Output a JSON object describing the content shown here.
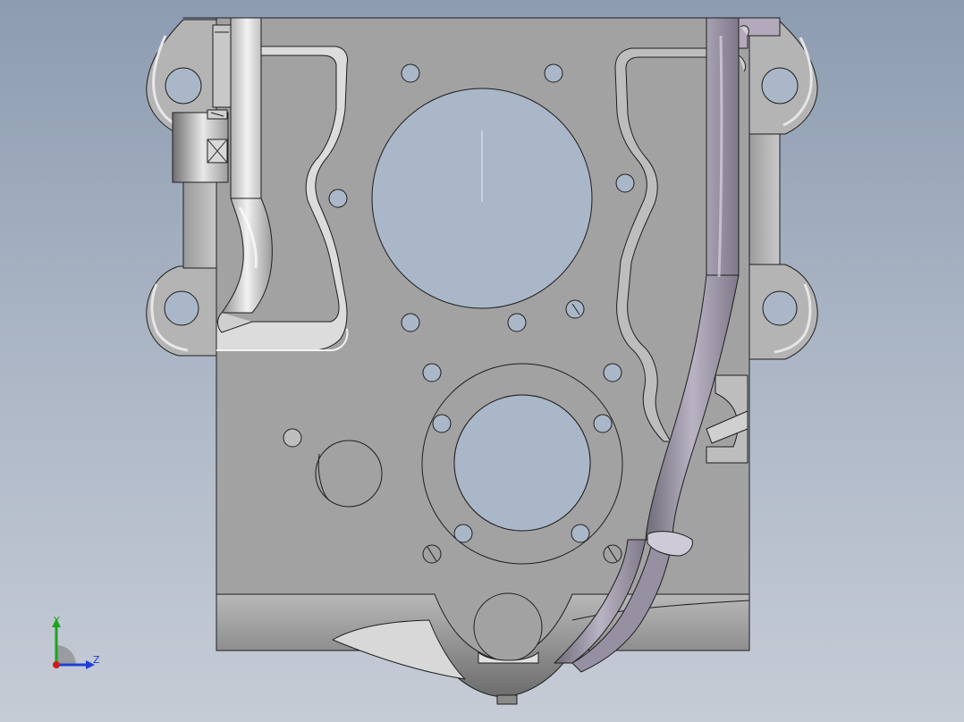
{
  "window": {
    "title": ""
  },
  "triad": {
    "y_label": "Y",
    "z_label": "Z",
    "y_color": "#1aa51a",
    "z_color": "#1f3fd6",
    "x_color": "#d01a1a"
  },
  "colors": {
    "background_top": "#8d9cb1",
    "background_bottom": "#c6ccd6",
    "part_face": "#a2a2a2",
    "part_edge": "#1e1e1e",
    "bore_fill": "#a9b7c8"
  }
}
